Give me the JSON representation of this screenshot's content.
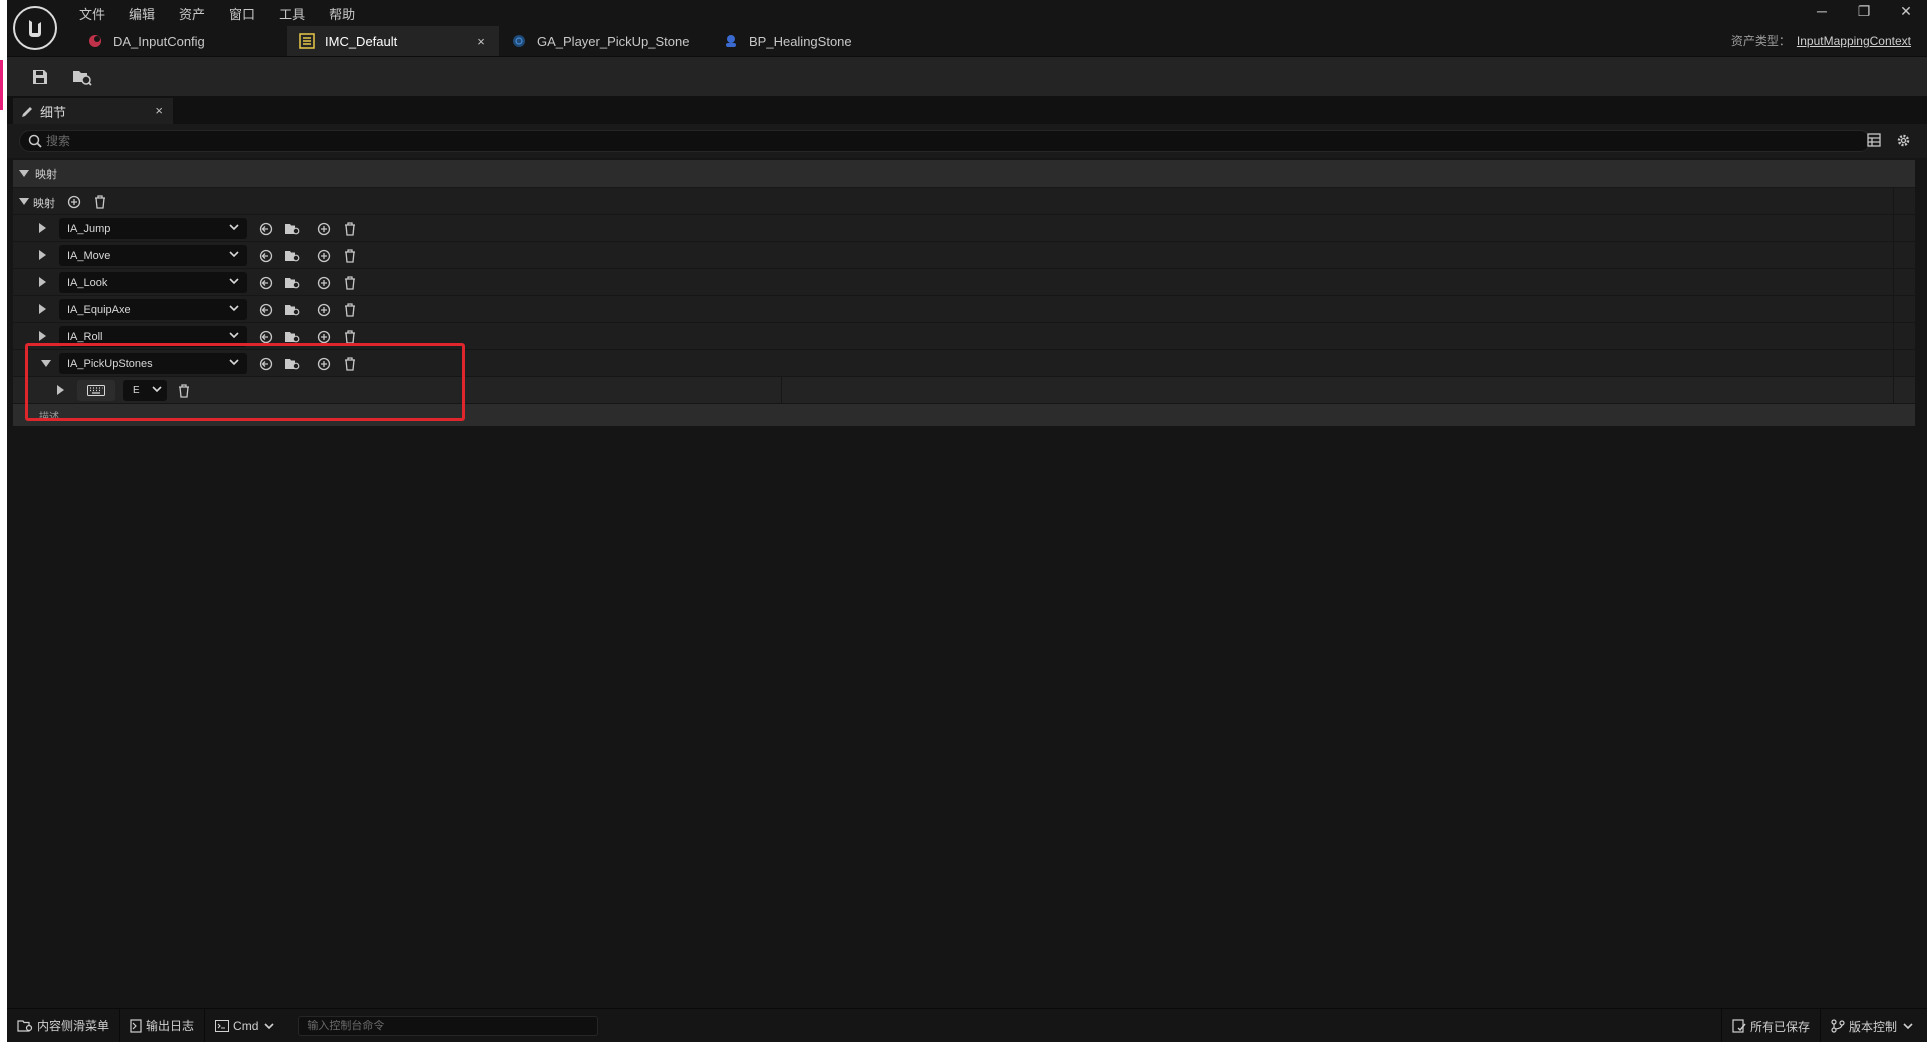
{
  "menu": [
    "文件",
    "编辑",
    "资产",
    "窗口",
    "工具",
    "帮助"
  ],
  "window_controls": {
    "minimize": "─",
    "restore": "❐",
    "close": "✕"
  },
  "tabs": [
    {
      "label": "DA_InputConfig",
      "icon": "data-asset-icon",
      "color": "#c0324a"
    },
    {
      "label": "IMC_Default",
      "icon": "input-mapping-icon",
      "color": "#e8c84a",
      "close": "×"
    },
    {
      "label": "GA_Player_PickUp_Stone",
      "icon": "blueprint-icon",
      "color": "#2a6aa8"
    },
    {
      "label": "BP_HealingStone",
      "icon": "blueprint-actor-icon",
      "color": "#3a6ad0"
    }
  ],
  "asset_type": {
    "label": "资产类型：",
    "value": "InputMappingContext"
  },
  "panel": {
    "title": "细节",
    "close": "×"
  },
  "search": {
    "placeholder": "搜索"
  },
  "category": {
    "label": "映射"
  },
  "mappings_header": {
    "label": "映射"
  },
  "mappings": [
    {
      "action": "IA_Jump"
    },
    {
      "action": "IA_Move"
    },
    {
      "action": "IA_Look"
    },
    {
      "action": "IA_EquipAxe"
    },
    {
      "action": "IA_Roll"
    },
    {
      "action": "IA_PickUpStones",
      "expanded": true,
      "key": "E"
    }
  ],
  "description": {
    "label": "描述"
  },
  "statusbar": {
    "content_drawer": "内容侧滑菜单",
    "output_log": "输出日志",
    "cmd": "Cmd",
    "cmd_placeholder": "输入控制台命令",
    "all_saved": "所有已保存",
    "source_control": "版本控制"
  }
}
